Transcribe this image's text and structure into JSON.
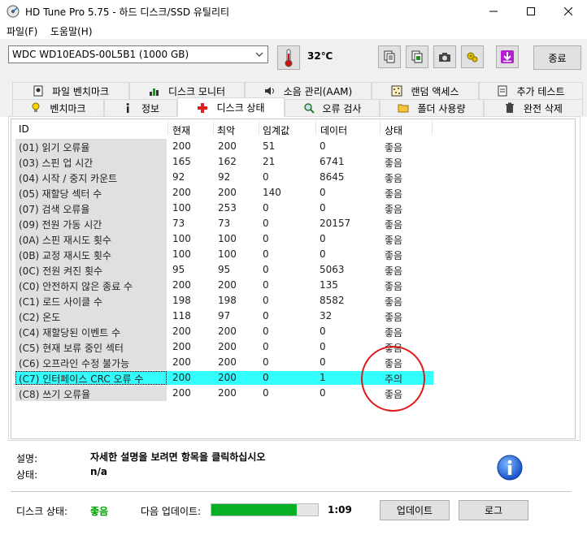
{
  "window": {
    "title": "HD Tune Pro 5.75 - 하드 디스크/SSD 유틸리티"
  },
  "menu": {
    "file": "파일(F)",
    "help": "도움말(H)"
  },
  "toolbar": {
    "drive": "WDC WD10EADS-00L5B1 (1000 GB)",
    "temperature": "32℃",
    "exit_label": "종료",
    "icons": [
      "copy-text-icon",
      "copy-screen-icon",
      "camera-icon",
      "settings-icon",
      "download-icon"
    ]
  },
  "tabs": {
    "row1": [
      "파일 벤치마크",
      "디스크 모니터",
      "소음 관리(AAM)",
      "랜덤 액세스",
      "추가 테스트"
    ],
    "row2": [
      "벤치마크",
      "정보",
      "디스크 상태",
      "오류 검사",
      "폴더 사용량",
      "완전 삭제"
    ],
    "active": "디스크 상태"
  },
  "table": {
    "headers": [
      "ID",
      "현재",
      "최악",
      "임계값",
      "데이터",
      "상태"
    ],
    "rows": [
      [
        "(01) 읽기 오류율",
        "200",
        "200",
        "51",
        "0",
        "좋음"
      ],
      [
        "(03) 스핀 업 시간",
        "165",
        "162",
        "21",
        "6741",
        "좋음"
      ],
      [
        "(04) 시작 / 중지 카운트",
        "92",
        "92",
        "0",
        "8645",
        "좋음"
      ],
      [
        "(05) 재할당 섹터 수",
        "200",
        "200",
        "140",
        "0",
        "좋음"
      ],
      [
        "(07) 검색 오류율",
        "100",
        "253",
        "0",
        "0",
        "좋음"
      ],
      [
        "(09) 전원 가동 시간",
        "73",
        "73",
        "0",
        "20157",
        "좋음"
      ],
      [
        "(0A) 스핀 재시도 횟수",
        "100",
        "100",
        "0",
        "0",
        "좋음"
      ],
      [
        "(0B) 교정 재시도 횟수",
        "100",
        "100",
        "0",
        "0",
        "좋음"
      ],
      [
        "(0C) 전원 켜진 횟수",
        "95",
        "95",
        "0",
        "5063",
        "좋음"
      ],
      [
        "(C0) 안전하지 않은 종료 수",
        "200",
        "200",
        "0",
        "135",
        "좋음"
      ],
      [
        "(C1) 로드 사이클 수",
        "198",
        "198",
        "0",
        "8582",
        "좋음"
      ],
      [
        "(C2) 온도",
        "118",
        "97",
        "0",
        "32",
        "좋음"
      ],
      [
        "(C4) 재할당된 이벤트 수",
        "200",
        "200",
        "0",
        "0",
        "좋음"
      ],
      [
        "(C5) 현재 보류 중인 섹터",
        "200",
        "200",
        "0",
        "0",
        "좋음"
      ],
      [
        "(C6) 오프라인 수정 불가능",
        "200",
        "200",
        "0",
        "0",
        "좋음"
      ],
      [
        "(C7) 인터페이스 CRC 오류 수",
        "200",
        "200",
        "0",
        "1",
        "주의"
      ],
      [
        "(C8) 쓰기 오류율",
        "200",
        "200",
        "0",
        "0",
        "좋음"
      ]
    ],
    "highlight_color": "#33ffff",
    "warning_circle_color": "#e01818"
  },
  "info": {
    "desc_label": "설명:",
    "desc_value": "자세한 설명을 보려면 항목을 클릭하십시오",
    "status_label": "상태:",
    "status_value": "n/a"
  },
  "bottom": {
    "disk_status_label": "디스크 상태:",
    "disk_status_value": "좋음",
    "next_update_label": "다음 업데이트:",
    "progress_fraction": 0.8,
    "timer": "1:09",
    "update_button": "업데이트",
    "log_button": "로그"
  }
}
